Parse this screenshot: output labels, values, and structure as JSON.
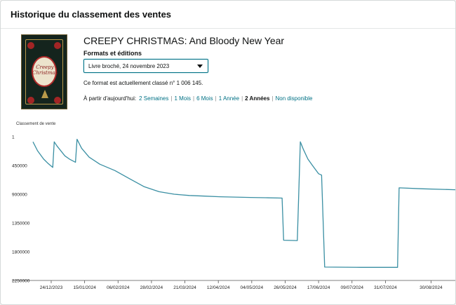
{
  "header": {
    "title": "Historique du classement des ventes"
  },
  "book": {
    "title": "CREEPY CHRISTMAS: And Bloody New Year",
    "cover_text": "Creepy Christmas",
    "formats_label": "Formats et éditions",
    "selected_format": "Livre broché, 24 novembre 2023",
    "rank_text": "Ce format est actuellement classé n° 1 006 145."
  },
  "range": {
    "prefix": "À partir d'aujourd'hui:",
    "options": [
      "2 Semaines",
      "1 Mois",
      "6 Mois",
      "1 Année",
      "2 Années",
      "Non disponible"
    ],
    "active": "2 Années"
  },
  "colors": {
    "accent": "#007185",
    "line": "#3a8fa3"
  },
  "chart_data": {
    "type": "line",
    "title": "",
    "ylabel": "Classement de vente",
    "xlabel": "",
    "y_inverted": true,
    "ylim": [
      1,
      2250000
    ],
    "y_ticks": [
      1,
      450000,
      900000,
      1350000,
      1800000,
      2250000
    ],
    "y_tick_labels": [
      "1",
      "450000",
      "900000",
      "1350000",
      "1800000",
      "2250000"
    ],
    "x_tick_labels": [
      "24/12/2023",
      "15/01/2024",
      "06/02/2024",
      "28/02/2024",
      "21/03/2024",
      "12/04/2024",
      "04/05/2024",
      "26/05/2024",
      "17/06/2024",
      "09/07/2024",
      "31/07/2024",
      "30/08/2024"
    ],
    "x_start": "2023-12-12",
    "x_end": "2024-09-15",
    "grid": false,
    "series": [
      {
        "name": "",
        "points": [
          [
            "2023-12-12",
            80000
          ],
          [
            "2023-12-15",
            220000
          ],
          [
            "2023-12-19",
            350000
          ],
          [
            "2023-12-22",
            420000
          ],
          [
            "2023-12-25",
            480000
          ],
          [
            "2023-12-26",
            80000
          ],
          [
            "2023-12-28",
            150000
          ],
          [
            "2024-01-02",
            300000
          ],
          [
            "2024-01-05",
            350000
          ],
          [
            "2024-01-09",
            400000
          ],
          [
            "2024-01-10",
            40000
          ],
          [
            "2024-01-13",
            180000
          ],
          [
            "2024-01-18",
            320000
          ],
          [
            "2024-01-25",
            430000
          ],
          [
            "2024-02-04",
            530000
          ],
          [
            "2024-02-13",
            650000
          ],
          [
            "2024-02-23",
            780000
          ],
          [
            "2024-03-04",
            860000
          ],
          [
            "2024-03-14",
            900000
          ],
          [
            "2024-03-24",
            920000
          ],
          [
            "2024-04-03",
            930000
          ],
          [
            "2024-04-13",
            940000
          ],
          [
            "2024-04-23",
            945000
          ],
          [
            "2024-05-03",
            950000
          ],
          [
            "2024-05-13",
            955000
          ],
          [
            "2024-05-24",
            960000
          ],
          [
            "2024-05-25",
            1620000
          ],
          [
            "2024-06-03",
            1625000
          ],
          [
            "2024-06-05",
            80000
          ],
          [
            "2024-06-07",
            200000
          ],
          [
            "2024-06-10",
            350000
          ],
          [
            "2024-06-13",
            450000
          ],
          [
            "2024-06-17",
            580000
          ],
          [
            "2024-06-19",
            600000
          ],
          [
            "2024-06-21",
            2040000
          ],
          [
            "2024-07-15",
            2045000
          ],
          [
            "2024-08-08",
            2045000
          ],
          [
            "2024-08-09",
            800000
          ],
          [
            "2024-08-25",
            815000
          ],
          [
            "2024-09-15",
            830000
          ]
        ]
      }
    ]
  }
}
